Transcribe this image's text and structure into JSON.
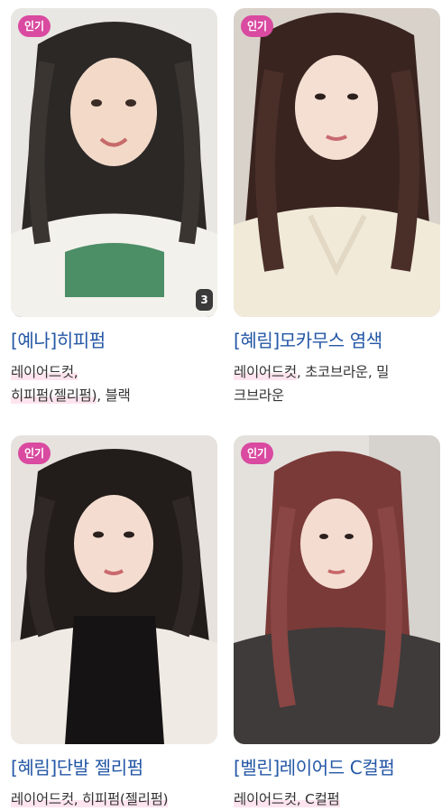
{
  "theme": {
    "accent": "#d94aa0",
    "title_color": "#2457a6",
    "count_badge_bg": "#3a3a3a",
    "tag_highlight": "#fde4ee"
  },
  "cards": [
    {
      "badge": "인기",
      "photo_count": "3",
      "title": "[예나]히피펌",
      "tags_line1": "레이어드컷,",
      "tags_line2_hl": "히피펌(젤리펌)",
      "tags_line2_rest": ", 블랙",
      "photo_icon": "portrait-photo"
    },
    {
      "badge": "인기",
      "title": "[혜림]모카무스 염색",
      "tags_line1_hl": "레이어드컷",
      "tags_line1_rest": ", 초코브라운, 밀",
      "tags_line2": "크브라운",
      "photo_icon": "portrait-photo"
    },
    {
      "badge": "인기",
      "title": "[혜림]단발 젤리펌",
      "tags_line1": "레이어드컷, 히피펌(젤리펌)",
      "photo_icon": "portrait-photo"
    },
    {
      "badge": "인기",
      "title": "[벨린]레이어드 C컬펌",
      "tags_line1": "레이어드컷, C컬펌",
      "photo_icon": "portrait-photo"
    }
  ]
}
